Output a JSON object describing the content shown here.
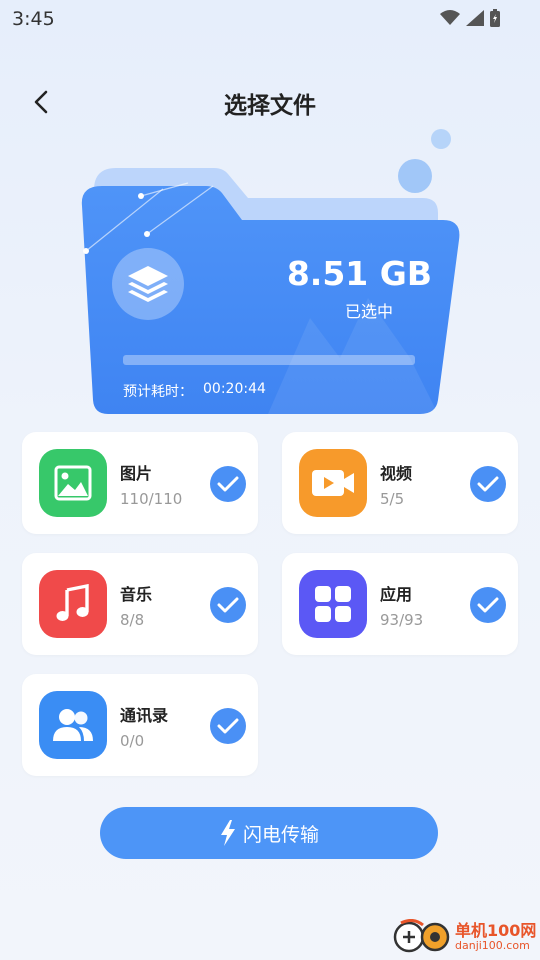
{
  "status_bar": {
    "time": "3:45"
  },
  "header": {
    "title": "选择文件"
  },
  "summary": {
    "size": "8.51 GB",
    "selected_label": "已选中",
    "eta_label": "预计耗时：",
    "eta_value": "00:20:44",
    "progress_fraction": 0
  },
  "categories": [
    {
      "label": "图片",
      "count": "110/110",
      "color": "#37c86a",
      "icon": "image-icon"
    },
    {
      "label": "视频",
      "count": "5/5",
      "color": "#f79a2b",
      "icon": "video-icon"
    },
    {
      "label": "音乐",
      "count": "8/8",
      "color": "#f04a4a",
      "icon": "music-note-icon"
    },
    {
      "label": "应用",
      "count": "93/93",
      "color": "#5b58f5",
      "icon": "app-grid-icon"
    },
    {
      "label": "通讯录",
      "count": "0/0",
      "color": "#3a8df4",
      "icon": "contacts-icon"
    }
  ],
  "action": {
    "transfer_label": "闪电传输"
  },
  "watermark": {
    "name": "单机100网",
    "domain": "danji100.com"
  },
  "colors": {
    "accent": "#4a90f5",
    "folder": "#4a8ef6",
    "folder_back": "#b9d4fb"
  }
}
